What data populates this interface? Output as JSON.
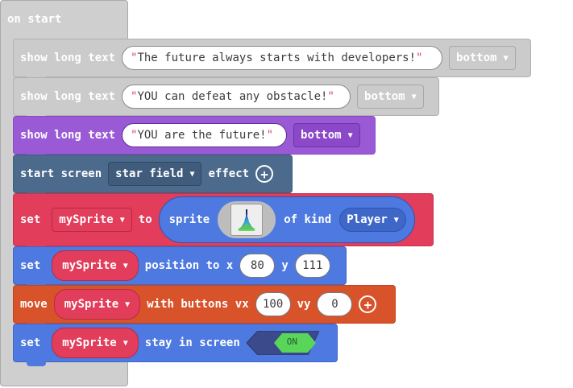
{
  "hat": {
    "label": "on start"
  },
  "block1": {
    "label": "show long text",
    "text": "The future always starts with developers!",
    "position": "bottom"
  },
  "block2": {
    "label": "show long text",
    "text": "YOU can defeat any obstacle!",
    "position": "bottom"
  },
  "block3": {
    "label": "show long text",
    "text": "YOU are the future!",
    "position": "bottom"
  },
  "block4": {
    "label": "start screen",
    "effect": "star field",
    "suffix": "effect"
  },
  "block5": {
    "set_label": "set",
    "variable": "mySprite",
    "to_label": "to",
    "sprite_label": "sprite",
    "of_kind_label": "of kind",
    "kind": "Player"
  },
  "block6": {
    "set_label": "set",
    "variable": "mySprite",
    "position_label": "position to x",
    "x": "80",
    "y_label": "y",
    "y": "111"
  },
  "block7": {
    "move_label": "move",
    "variable": "mySprite",
    "with_label": "with buttons vx",
    "vx": "100",
    "vy_label": "vy",
    "vy": "0"
  },
  "block8": {
    "set_label": "set",
    "variable": "mySprite",
    "stay_label": "stay in screen",
    "toggle": "ON"
  },
  "icons": {
    "dropdown": "chevron-down-icon",
    "add": "plus-circle-icon",
    "sprite": "sprite-thumbnail-icon"
  },
  "colors": {
    "disabled": "#cbcbcb",
    "purple": "#9a5ad6",
    "slate": "#4b6a8c",
    "red": "#e23d5b",
    "blue": "#4d79e0",
    "orange": "#d8522a",
    "toggle_on": "#59d659"
  }
}
